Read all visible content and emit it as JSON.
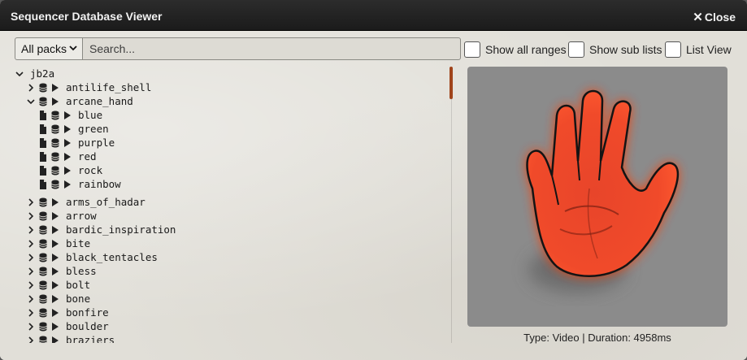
{
  "window": {
    "title": "Sequencer Database Viewer",
    "close_label": "Close"
  },
  "toolbar": {
    "pack_select": "All packs",
    "search_placeholder": "Search...",
    "show_all_ranges": "Show all ranges",
    "show_sub_lists": "Show sub lists",
    "list_view": "List View"
  },
  "tree": {
    "root": "jb2a",
    "items": [
      {
        "label": "antilife_shell",
        "level": 1,
        "expanded": false
      },
      {
        "label": "arcane_hand",
        "level": 1,
        "expanded": true
      },
      {
        "label": "blue",
        "level": 2
      },
      {
        "label": "green",
        "level": 2
      },
      {
        "label": "purple",
        "level": 2
      },
      {
        "label": "red",
        "level": 2
      },
      {
        "label": "rock",
        "level": 2
      },
      {
        "label": "rainbow",
        "level": 2
      },
      {
        "label": "arms_of_hadar",
        "level": 1,
        "expanded": false
      },
      {
        "label": "arrow",
        "level": 1,
        "expanded": false
      },
      {
        "label": "bardic_inspiration",
        "level": 1,
        "expanded": false
      },
      {
        "label": "bite",
        "level": 1,
        "expanded": false
      },
      {
        "label": "black_tentacles",
        "level": 1,
        "expanded": false
      },
      {
        "label": "bless",
        "level": 1,
        "expanded": false
      },
      {
        "label": "bolt",
        "level": 1,
        "expanded": false
      },
      {
        "label": "bone",
        "level": 1,
        "expanded": false
      },
      {
        "label": "bonfire",
        "level": 1,
        "expanded": false
      },
      {
        "label": "boulder",
        "level": 1,
        "expanded": false
      },
      {
        "label": "braziers",
        "level": 1,
        "expanded": false
      }
    ]
  },
  "preview": {
    "caption": "Type: Video | Duration: 4958ms",
    "icon": "arcane-hand-preview"
  },
  "colors": {
    "accent": "#a0441b",
    "titlebar": "#1f1f1f",
    "glow": "#ff3a10"
  }
}
